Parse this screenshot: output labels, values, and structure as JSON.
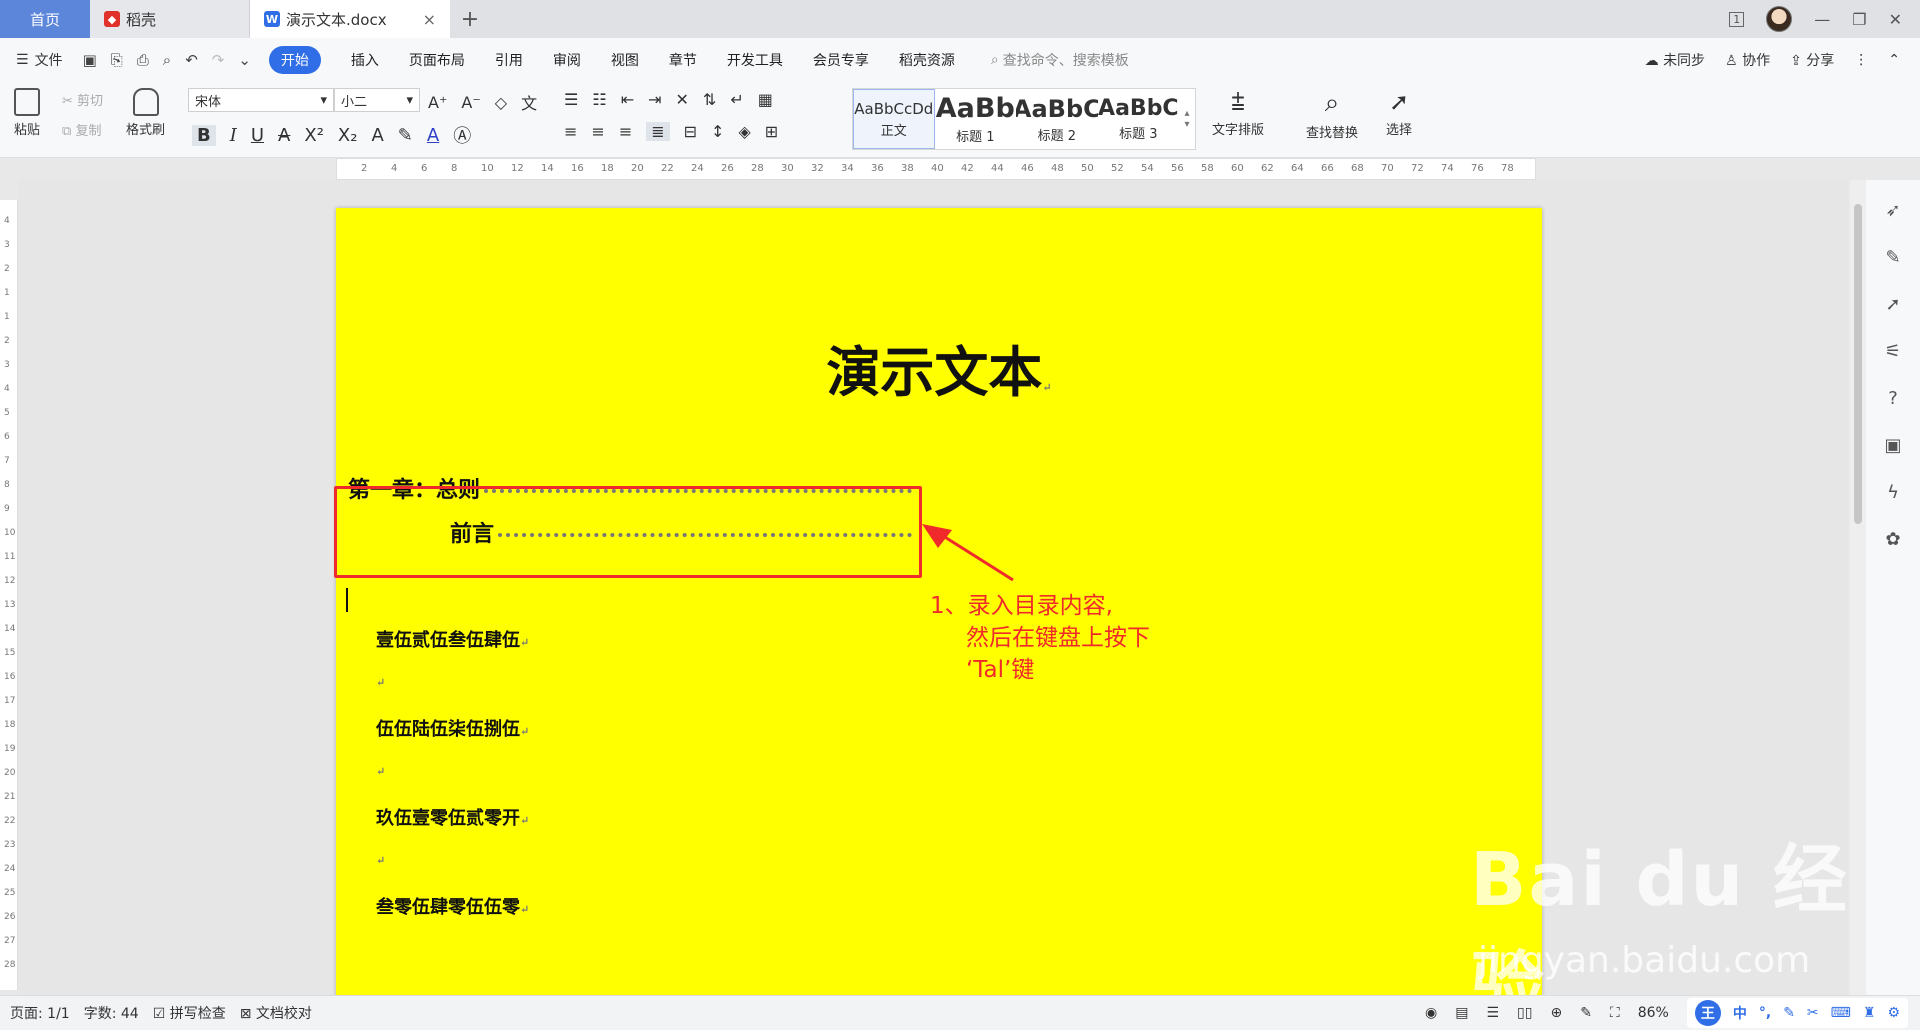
{
  "tabs": {
    "home": "首页",
    "daoke": "稻壳",
    "doc": "演示文本.docx",
    "close": "×",
    "add": "+"
  },
  "window": {
    "badge": "1",
    "minimize": "—",
    "restore": "❐",
    "close": "✕"
  },
  "menubar": {
    "file": "文件",
    "items": [
      "开始",
      "插入",
      "页面布局",
      "引用",
      "审阅",
      "视图",
      "章节",
      "开发工具",
      "会员专享",
      "稻壳资源"
    ],
    "search_placeholder": "查找命令、搜索模板",
    "sync": "未同步",
    "collab": "协作",
    "share": "分享"
  },
  "ribbon": {
    "paste": "粘贴",
    "cut": "剪切",
    "copy": "复制",
    "format_painter": "格式刷",
    "font_name": "宋体",
    "font_size": "小二",
    "styles": [
      {
        "sample": "AaBbCcDd",
        "name": "正文"
      },
      {
        "sample": "AaBb",
        "name": "标题 1"
      },
      {
        "sample": "AaBbC",
        "name": "标题 2"
      },
      {
        "sample": "AaBbC",
        "name": "标题 3"
      }
    ],
    "text_layout": "文字排版",
    "find_replace": "查找替换",
    "select": "选择"
  },
  "ruler_ticks": [
    "2",
    "4",
    "6",
    "8",
    "10",
    "12",
    "14",
    "16",
    "18",
    "20",
    "22",
    "24",
    "26",
    "28",
    "30",
    "32",
    "34",
    "36",
    "38",
    "40",
    "42",
    "44",
    "46",
    "48",
    "50",
    "52",
    "54",
    "56",
    "58",
    "60",
    "62",
    "64",
    "66",
    "68",
    "70",
    "72",
    "74",
    "76",
    "78"
  ],
  "vruler_ticks": [
    "4",
    "3",
    "2",
    "1",
    "1",
    "2",
    "3",
    "4",
    "5",
    "6",
    "7",
    "8",
    "9",
    "10",
    "11",
    "12",
    "13",
    "14",
    "15",
    "16",
    "17",
    "18",
    "19",
    "20",
    "21",
    "22",
    "23",
    "24",
    "25",
    "26",
    "27",
    "28"
  ],
  "document": {
    "title": "演示文本",
    "toc": [
      {
        "text": "第一章：总则",
        "level": 1
      },
      {
        "text": "前言",
        "level": 2
      }
    ],
    "body": [
      "壹伍贰伍叁伍肆伍",
      "伍伍陆伍柒伍捌伍",
      "玖伍壹零伍贰零开",
      "叁零伍肆零伍伍零"
    ],
    "annotation": [
      "1、录入目录内容,",
      "然后在键盘上按下",
      "‘Tal’键"
    ]
  },
  "watermark": {
    "main": "Bai du 经验",
    "sub": "jingyan.baidu.com"
  },
  "status": {
    "page": "页面: 1/1",
    "words": "字数: 44",
    "spell": "拼写检查",
    "proof": "文档校对",
    "zoom": "86%"
  },
  "ime": {
    "king": "王",
    "lang": "中"
  }
}
